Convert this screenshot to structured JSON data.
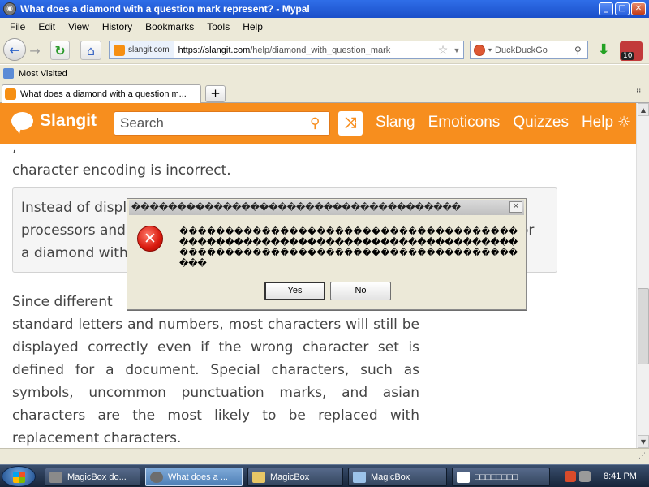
{
  "window": {
    "title": "What does a diamond with a question mark represent? - Mypal",
    "buttons": {
      "minimize": "_",
      "maximize": "□",
      "close": "✕"
    }
  },
  "menu": [
    "File",
    "Edit",
    "View",
    "History",
    "Bookmarks",
    "Tools",
    "Help"
  ],
  "navbar": {
    "site_badge": "slangit.com",
    "url_domain": "https://slangit.com",
    "url_path": "/help/diamond_with_question_mark",
    "search_engine": "DuckDuckGo",
    "addon_badge": "10"
  },
  "bookmarks": {
    "most_visited": "Most Visited"
  },
  "tab": {
    "label": "What does a diamond with a question m..."
  },
  "site": {
    "logo": "Slangit",
    "search_placeholder": "Search",
    "nav": [
      "Slang",
      "Emoticons",
      "Quizzes",
      "Help"
    ]
  },
  "content": {
    "top_line_fragment": "            ,                                           ",
    "top_line": "character encoding is incorrect.",
    "quote": "Instead of displaying ... processors and ... a diamond with ...",
    "quote_line1": "Instead of displ",
    "quote_line2": "processors and",
    "quote_line2_tail": "or",
    "quote_line3": "a diamond with",
    "main_paragraph_start": "Since different",
    "main_paragraph": "standard letters and numbers, most characters will still be displayed correctly even if the wrong character set is defined for a document. Special characters, such as symbols, uncommon punctuation marks, and asian characters are the most likely to be replaced with replacement characters."
  },
  "dialog": {
    "title": "������������������������������������",
    "message": "������������������������������������������������������������������������������������������������������������������",
    "yes": "Yes",
    "no": "No",
    "close": "✕"
  },
  "taskbar": {
    "tasks": [
      {
        "label": "MagicBox do...",
        "active": false
      },
      {
        "label": "What does a ...",
        "active": true
      },
      {
        "label": "MagicBox",
        "active": false
      },
      {
        "label": "MagicBox",
        "active": false
      },
      {
        "label": "□□□□□□□□",
        "active": false
      }
    ],
    "clock": "8:41 PM"
  }
}
